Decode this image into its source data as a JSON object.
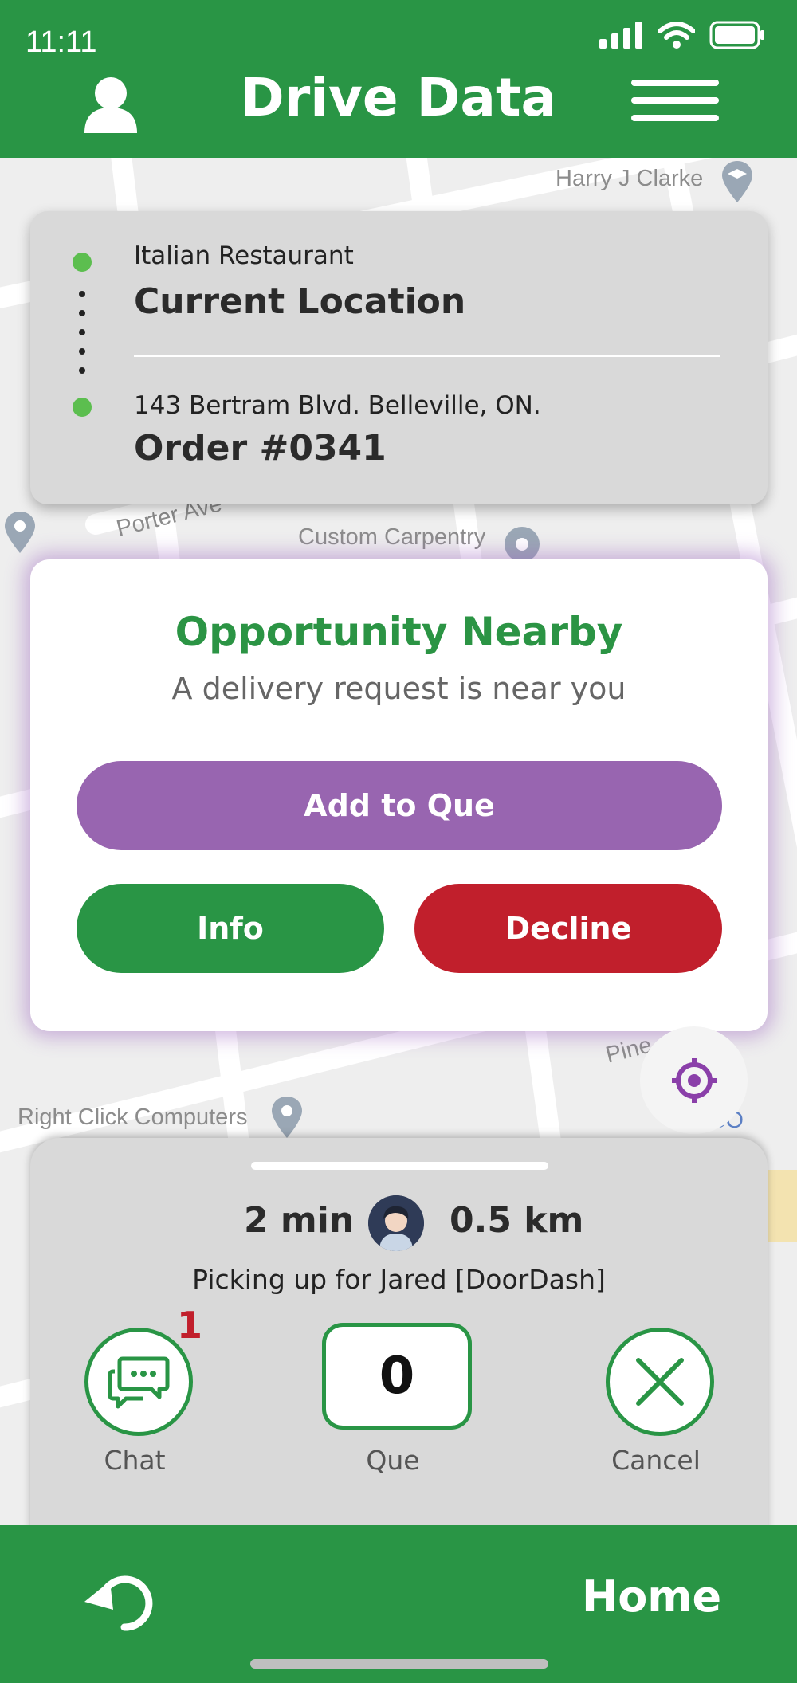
{
  "status_bar": {
    "time": "11:11"
  },
  "header": {
    "title": "Drive Data"
  },
  "map": {
    "labels": [
      "Harry J Clarke",
      "Porter Ave",
      "Custom Carpentry",
      "Right Click Computers",
      "LCBO",
      "Pine"
    ]
  },
  "route": {
    "origin_sub": "Italian Restaurant",
    "origin_main": "Current Location",
    "dest_sub": "143 Bertram Blvd. Belleville, ON.",
    "dest_main": "Order #0341"
  },
  "opportunity": {
    "title": "Opportunity Nearby",
    "subtitle": "A delivery request is near you",
    "add_label": "Add to Que",
    "info_label": "Info",
    "decline_label": "Decline"
  },
  "trip": {
    "eta": "2 min",
    "distance": "0.5 km",
    "pickup_text": "Picking up for Jared [DoorDash]",
    "chat_label": "Chat",
    "chat_badge": "1",
    "que_count": "0",
    "que_label": "Que",
    "cancel_label": "Cancel"
  },
  "footer": {
    "home_label": "Home"
  },
  "colors": {
    "brand_green": "#299545",
    "accent_purple": "#9865b0",
    "decline_red": "#c11f2c",
    "route_dot": "#5cbe4f"
  }
}
